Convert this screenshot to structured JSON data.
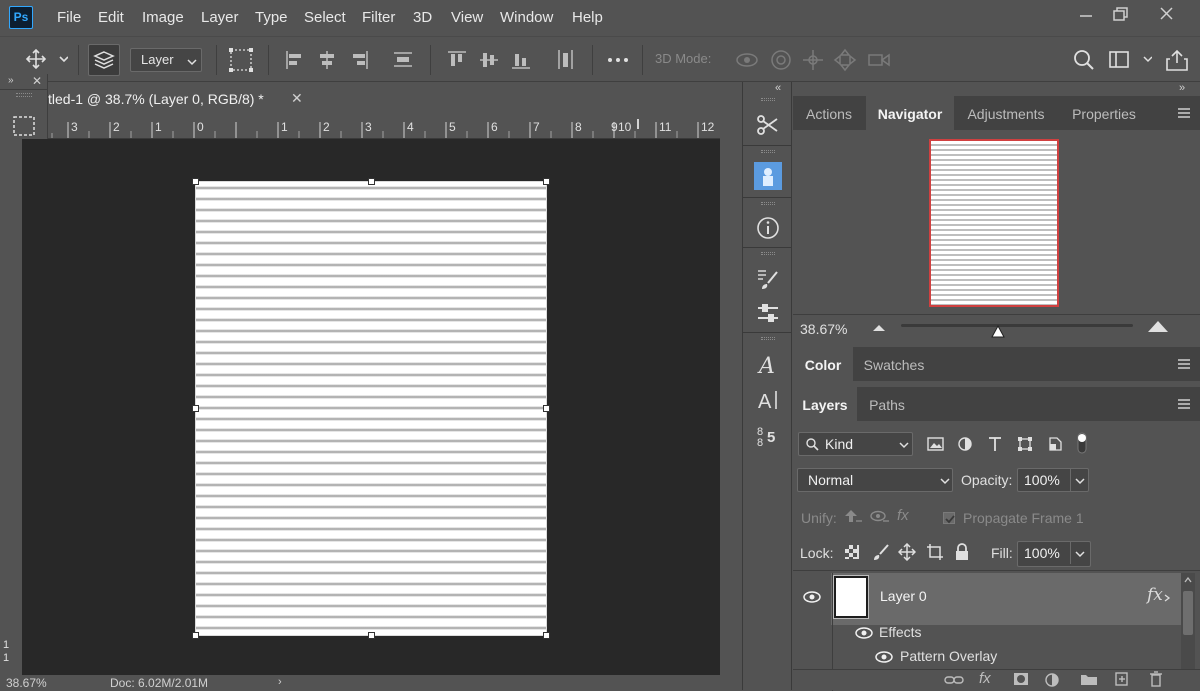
{
  "app": {
    "logo": "Ps"
  },
  "menu": [
    "File",
    "Edit",
    "Image",
    "Layer",
    "Type",
    "Select",
    "Filter",
    "3D",
    "View",
    "Window",
    "Help"
  ],
  "options": {
    "layer_select": "Layer",
    "mode3d_label": "3D Mode:"
  },
  "document": {
    "tab_title": "tled-1 @ 38.7% (Layer 0, RGB/8) *",
    "ruler_h": [
      "3",
      "2",
      "1",
      "0",
      "1",
      "2",
      "3",
      "4",
      "5",
      "6",
      "7",
      "8",
      "9",
      "10",
      "11",
      "12"
    ],
    "ruler_v": [
      "1",
      "1"
    ]
  },
  "status": {
    "zoom": "38.67%",
    "doc_size": "Doc: 6.02M/2.01M"
  },
  "colors": {
    "foreground": "#2ee88a",
    "background": "#ffffff",
    "accent": "#31a8ff"
  },
  "panels": {
    "top_tabs": [
      "Actions",
      "Navigator",
      "Adjustments",
      "Properties"
    ],
    "navigator": {
      "zoom": "38.67%"
    },
    "color_tabs": [
      "Color",
      "Swatches"
    ],
    "layers_tabs": [
      "Layers",
      "Paths"
    ]
  },
  "layers": {
    "filter_kind": "Kind",
    "blend_mode": "Normal",
    "opacity_label": "Opacity:",
    "opacity_value": "100%",
    "unify_label": "Unify:",
    "propagate_label": "Propagate Frame 1",
    "lock_label": "Lock:",
    "fill_label": "Fill:",
    "fill_value": "100%",
    "layer_name": "Layer 0",
    "fx_label": "fx",
    "effects_label": "Effects",
    "effect_name": "Pattern Overlay"
  }
}
